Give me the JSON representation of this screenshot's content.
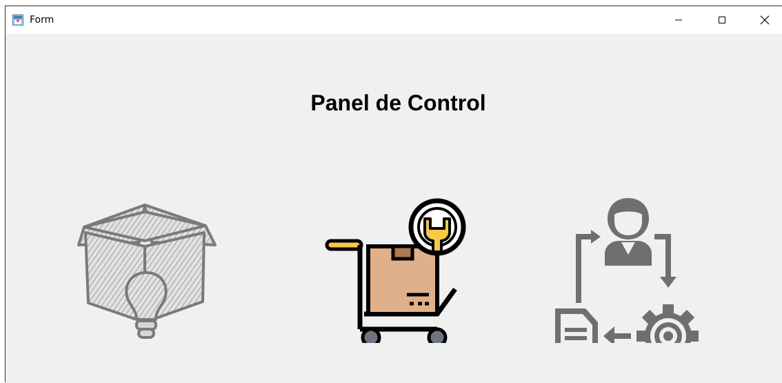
{
  "window": {
    "title": "Form",
    "controls": {
      "minimize": "minimize-icon",
      "maximize": "maximize-icon",
      "close": "close-icon"
    }
  },
  "main": {
    "heading": "Panel de Control",
    "tiles": [
      {
        "icon": "box-idea-icon"
      },
      {
        "icon": "cart-service-icon"
      },
      {
        "icon": "user-workflow-icon"
      }
    ]
  },
  "colors": {
    "background": "#f0f0f0",
    "gray_icon": "#6f6f6f",
    "box_brown": "#e0b08a",
    "yellow": "#f6c948"
  }
}
